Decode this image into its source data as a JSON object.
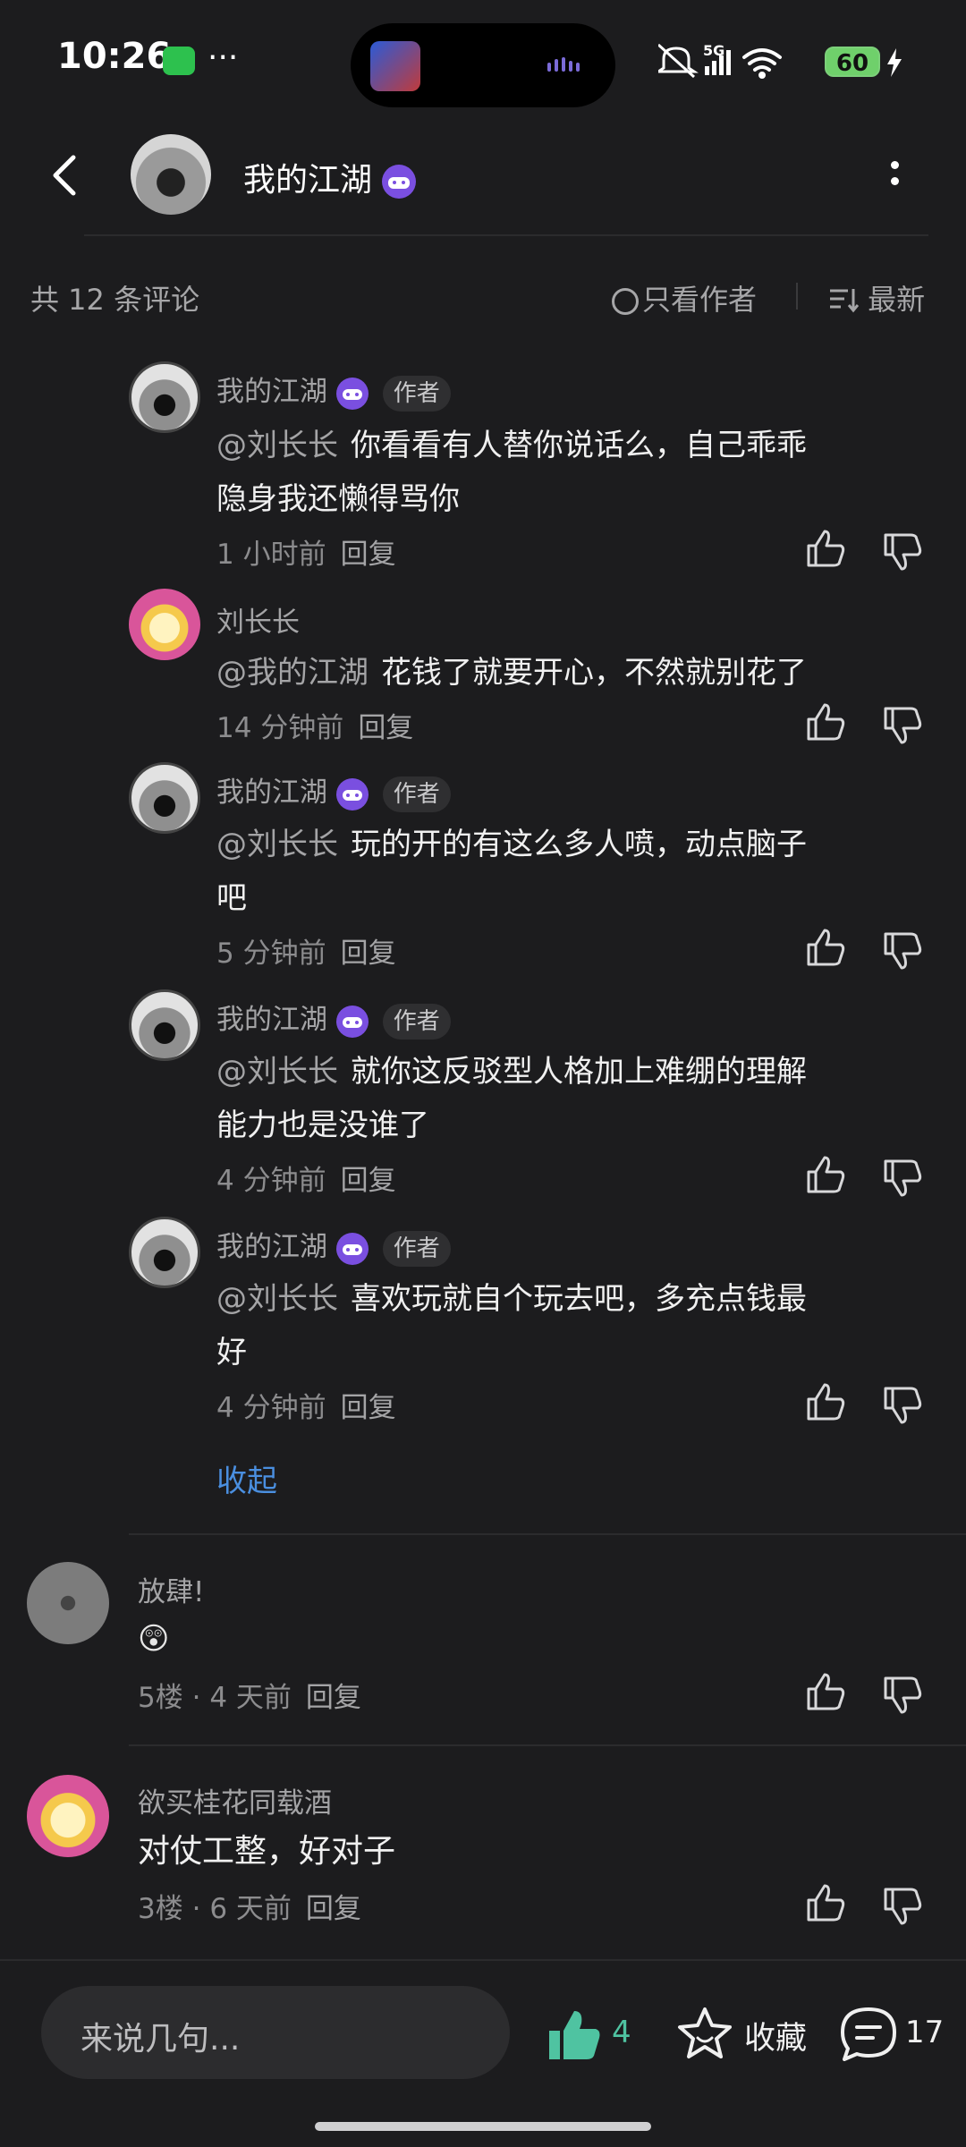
{
  "status_bar": {
    "time": "10:26",
    "battery": "60",
    "network": "5G"
  },
  "header": {
    "title": "我的江湖"
  },
  "filter": {
    "count_label": "共 12 条评论",
    "only_author": "只看作者",
    "sort": "最新"
  },
  "replies": [
    {
      "name": "我的江湖",
      "author_tag": "作者",
      "mention": "@刘长长",
      "text_line1": "你看看有人替你说话么，自己乖乖",
      "text_line2": "隐身我还懒得骂你",
      "time": "1 小时前",
      "reply": "回复"
    },
    {
      "name": "刘长长",
      "mention": "@我的江湖",
      "text_line1": "花钱了就要开心，不然就别花了",
      "time": "14 分钟前",
      "reply": "回复"
    },
    {
      "name": "我的江湖",
      "author_tag": "作者",
      "mention": "@刘长长",
      "text_line1": "玩的开的有这么多人喷，动点脑子",
      "text_line2": "吧",
      "time": "5 分钟前",
      "reply": "回复"
    },
    {
      "name": "我的江湖",
      "author_tag": "作者",
      "mention": "@刘长长",
      "text_line1": "就你这反驳型人格加上难绷的理解",
      "text_line2": "能力也是没谁了",
      "time": "4 分钟前",
      "reply": "回复"
    },
    {
      "name": "我的江湖",
      "author_tag": "作者",
      "mention": "@刘长长",
      "text_line1": "喜欢玩就自个玩去吧，多充点钱最",
      "text_line2": "好",
      "time": "4 分钟前",
      "reply": "回复"
    }
  ],
  "collapse_label": "收起",
  "comments": [
    {
      "name": "放肆!",
      "emoji": "😲",
      "floor": "5楼",
      "dot": "·",
      "time": "4 天前",
      "reply": "回复"
    },
    {
      "name": "欲买桂花同载酒",
      "text": "对仗工整，好对子",
      "floor": "3楼",
      "dot": "·",
      "time": "6 天前",
      "reply": "回复"
    }
  ],
  "bottom_bar": {
    "placeholder": "来说几句...",
    "likes": "4",
    "favorite": "收藏",
    "comments": "17"
  },
  "colors": {
    "background": "#1c1c1e",
    "accent_blue": "#4a8fe0",
    "like_green": "#4fc3a1",
    "badge_purple": "#7a4fe0"
  },
  "icons": [
    "back-arrow-icon",
    "game-badge-icon",
    "more-icon",
    "radio-circle-icon",
    "sort-icon",
    "thumb-up-icon",
    "thumb-down-icon",
    "star-icon",
    "comment-icon"
  ]
}
